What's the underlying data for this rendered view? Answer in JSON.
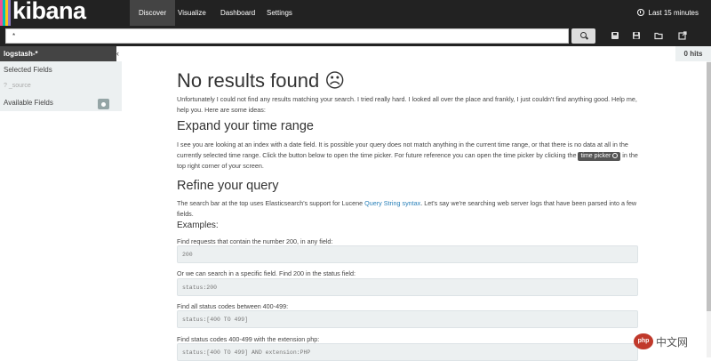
{
  "app": {
    "logo_text": "kibana",
    "logo_colors": [
      "#f04e98",
      "#00bfb3",
      "#fec514",
      "#8e7cc3"
    ]
  },
  "nav": {
    "tabs": [
      {
        "label": "Discover",
        "active": true
      },
      {
        "label": "Visualize",
        "active": false
      },
      {
        "label": "Dashboard",
        "active": false
      },
      {
        "label": "Settings",
        "active": false
      }
    ],
    "time_range_label": "Last 15 minutes"
  },
  "search": {
    "query": "*",
    "icons": [
      "search-icon",
      "save-icon",
      "load-icon",
      "open-icon",
      "share-icon"
    ]
  },
  "sidebar": {
    "index_pattern": "logstash-*",
    "selected_fields_label": "Selected Fields",
    "selected_fields": [
      "? _source"
    ],
    "available_fields_label": "Available Fields"
  },
  "hits": "0 hits",
  "main": {
    "title": "No results found ☹",
    "intro": "Unfortunately I could not find any results matching your search. I tried really hard. I looked all over the place and frankly, I just couldn't find anything good. Help me, help you. Here are some ideas:",
    "expand": {
      "heading": "Expand your time range",
      "text_before": "I see you are looking at an index with a date field. It is possible your query does not match anything in the current time range, or that there is no data at all in the currently selected time range. Click the button below to open the time picker. For future reference you can open the time picker by clicking the",
      "button_label": "time picker",
      "text_after": "in the top right corner of your screen."
    },
    "refine": {
      "heading": "Refine your query",
      "text_before": "The search bar at the top uses Elasticsearch's support for Lucene",
      "link_label": "Query String syntax",
      "text_after": ". Let's say we're searching web server logs that have been parsed into a few fields."
    },
    "examples_heading": "Examples:",
    "examples": [
      {
        "description": "Find requests that contain the number 200, in any field:",
        "code": "200"
      },
      {
        "description": "Or we can search in a specific field. Find 200 in the status field:",
        "code": "status:200"
      },
      {
        "description": "Find all status codes between 400-499:",
        "code": "status:[400 TO 499]"
      },
      {
        "description": "Find status codes 400-499 with the extension php:",
        "code": "status:[400 TO 499] AND extension:PHP"
      }
    ]
  },
  "watermark": {
    "badge": "php",
    "text": "中文网"
  }
}
